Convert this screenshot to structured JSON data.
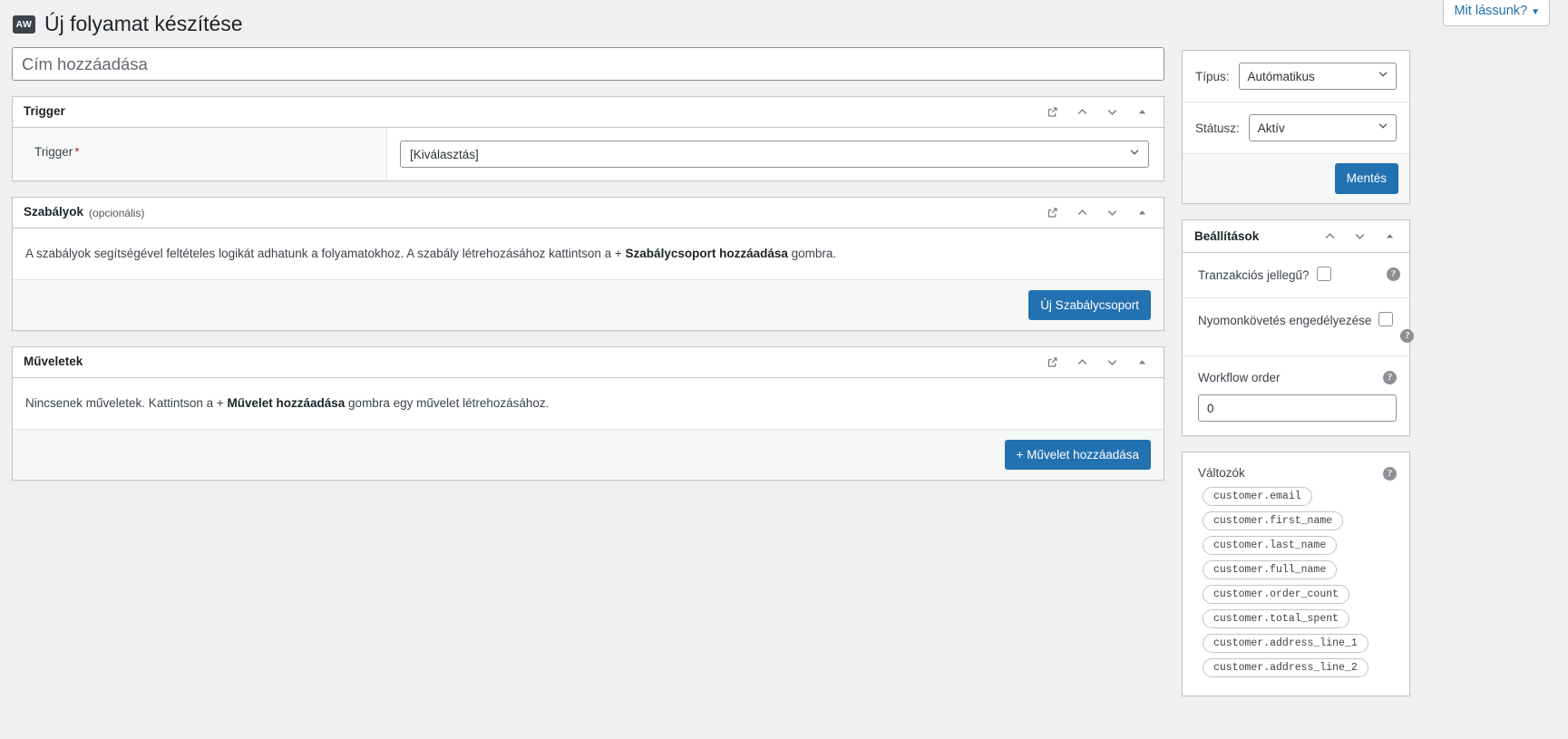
{
  "screen_meta": {
    "label": "Mit lássunk?",
    "caret": "▼"
  },
  "header": {
    "logo_text": "AW",
    "title": "Új folyamat készítése"
  },
  "title_field": {
    "placeholder": "Cím hozzáadása",
    "value": ""
  },
  "panels": {
    "trigger": {
      "title": "Trigger",
      "icons": [
        "external-link-icon",
        "chevron-up-icon",
        "chevron-down-icon",
        "collapse-toggle-icon"
      ],
      "field_label": "Trigger",
      "required_mark": "*",
      "select_value": "[Kiválasztás]",
      "select_caret": "⌄"
    },
    "rules": {
      "title": "Szabályok",
      "subtitle": "(opcionális)",
      "body_text_1": "A szabályok segítségével feltételes logikát adhatunk a folyamatokhoz. A szabály létrehozásához kattintson a + ",
      "body_bold": "Szabálycsoport hozzáadása",
      "body_text_2": " gombra.",
      "button_label": "Új Szabálycsoport"
    },
    "actions": {
      "title": "Műveletek",
      "body_text_1": "Nincsenek műveletek. Kattintson a + ",
      "body_bold": "Művelet hozzáadása",
      "body_text_2": " gombra egy művelet létrehozásához.",
      "button_label": "+ Művelet hozzáadása"
    }
  },
  "sidebar": {
    "publish": {
      "type_label": "Típus:",
      "type_value": "Autómatikus",
      "status_label": "Státusz:",
      "status_value": "Aktív",
      "save_label": "Mentés"
    },
    "settings": {
      "title": "Beállítások",
      "rows": [
        {
          "label": "Tranzakciós jellegű?",
          "checked": false
        },
        {
          "label": "Nyomonkövetés engedélyezése",
          "checked": false
        }
      ],
      "order_label": "Workflow order",
      "order_value": "0",
      "help_glyph": "?"
    },
    "variables": {
      "title": "Változók",
      "help_glyph": "?",
      "items": [
        "customer.email",
        "customer.first_name",
        "customer.last_name",
        "customer.full_name",
        "customer.order_count",
        "customer.total_spent",
        "customer.address_line_1",
        "customer.address_line_2"
      ]
    }
  },
  "colors": {
    "accent": "#2271b1",
    "page_bg": "#f0f0f1",
    "border": "#c3c4c7",
    "required": "#b32d2e"
  }
}
